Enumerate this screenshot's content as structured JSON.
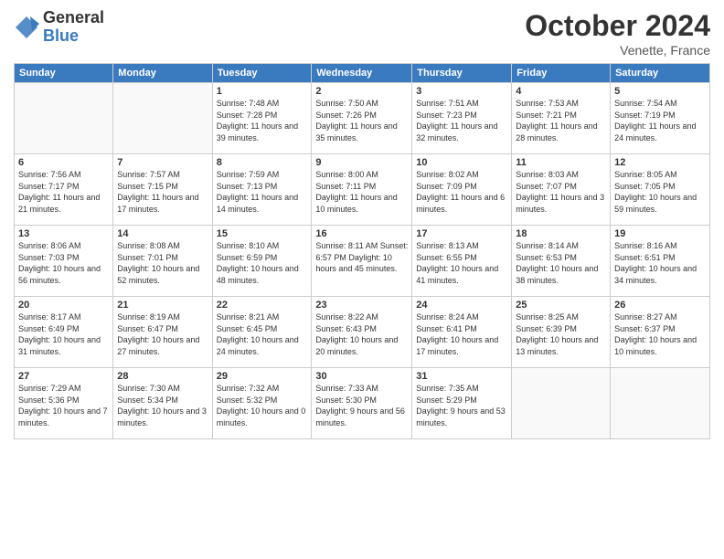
{
  "logo": {
    "general": "General",
    "blue": "Blue"
  },
  "header": {
    "month": "October 2024",
    "location": "Venette, France"
  },
  "weekdays": [
    "Sunday",
    "Monday",
    "Tuesday",
    "Wednesday",
    "Thursday",
    "Friday",
    "Saturday"
  ],
  "weeks": [
    [
      {
        "day": "",
        "info": ""
      },
      {
        "day": "",
        "info": ""
      },
      {
        "day": "1",
        "info": "Sunrise: 7:48 AM\nSunset: 7:28 PM\nDaylight: 11 hours and 39 minutes."
      },
      {
        "day": "2",
        "info": "Sunrise: 7:50 AM\nSunset: 7:26 PM\nDaylight: 11 hours and 35 minutes."
      },
      {
        "day": "3",
        "info": "Sunrise: 7:51 AM\nSunset: 7:23 PM\nDaylight: 11 hours and 32 minutes."
      },
      {
        "day": "4",
        "info": "Sunrise: 7:53 AM\nSunset: 7:21 PM\nDaylight: 11 hours and 28 minutes."
      },
      {
        "day": "5",
        "info": "Sunrise: 7:54 AM\nSunset: 7:19 PM\nDaylight: 11 hours and 24 minutes."
      }
    ],
    [
      {
        "day": "6",
        "info": "Sunrise: 7:56 AM\nSunset: 7:17 PM\nDaylight: 11 hours and 21 minutes."
      },
      {
        "day": "7",
        "info": "Sunrise: 7:57 AM\nSunset: 7:15 PM\nDaylight: 11 hours and 17 minutes."
      },
      {
        "day": "8",
        "info": "Sunrise: 7:59 AM\nSunset: 7:13 PM\nDaylight: 11 hours and 14 minutes."
      },
      {
        "day": "9",
        "info": "Sunrise: 8:00 AM\nSunset: 7:11 PM\nDaylight: 11 hours and 10 minutes."
      },
      {
        "day": "10",
        "info": "Sunrise: 8:02 AM\nSunset: 7:09 PM\nDaylight: 11 hours and 6 minutes."
      },
      {
        "day": "11",
        "info": "Sunrise: 8:03 AM\nSunset: 7:07 PM\nDaylight: 11 hours and 3 minutes."
      },
      {
        "day": "12",
        "info": "Sunrise: 8:05 AM\nSunset: 7:05 PM\nDaylight: 10 hours and 59 minutes."
      }
    ],
    [
      {
        "day": "13",
        "info": "Sunrise: 8:06 AM\nSunset: 7:03 PM\nDaylight: 10 hours and 56 minutes."
      },
      {
        "day": "14",
        "info": "Sunrise: 8:08 AM\nSunset: 7:01 PM\nDaylight: 10 hours and 52 minutes."
      },
      {
        "day": "15",
        "info": "Sunrise: 8:10 AM\nSunset: 6:59 PM\nDaylight: 10 hours and 48 minutes."
      },
      {
        "day": "16",
        "info": "Sunrise: 8:11 AM\nSunset: 6:57 PM\nDaylight: 10 hours and 45 minutes."
      },
      {
        "day": "17",
        "info": "Sunrise: 8:13 AM\nSunset: 6:55 PM\nDaylight: 10 hours and 41 minutes."
      },
      {
        "day": "18",
        "info": "Sunrise: 8:14 AM\nSunset: 6:53 PM\nDaylight: 10 hours and 38 minutes."
      },
      {
        "day": "19",
        "info": "Sunrise: 8:16 AM\nSunset: 6:51 PM\nDaylight: 10 hours and 34 minutes."
      }
    ],
    [
      {
        "day": "20",
        "info": "Sunrise: 8:17 AM\nSunset: 6:49 PM\nDaylight: 10 hours and 31 minutes."
      },
      {
        "day": "21",
        "info": "Sunrise: 8:19 AM\nSunset: 6:47 PM\nDaylight: 10 hours and 27 minutes."
      },
      {
        "day": "22",
        "info": "Sunrise: 8:21 AM\nSunset: 6:45 PM\nDaylight: 10 hours and 24 minutes."
      },
      {
        "day": "23",
        "info": "Sunrise: 8:22 AM\nSunset: 6:43 PM\nDaylight: 10 hours and 20 minutes."
      },
      {
        "day": "24",
        "info": "Sunrise: 8:24 AM\nSunset: 6:41 PM\nDaylight: 10 hours and 17 minutes."
      },
      {
        "day": "25",
        "info": "Sunrise: 8:25 AM\nSunset: 6:39 PM\nDaylight: 10 hours and 13 minutes."
      },
      {
        "day": "26",
        "info": "Sunrise: 8:27 AM\nSunset: 6:37 PM\nDaylight: 10 hours and 10 minutes."
      }
    ],
    [
      {
        "day": "27",
        "info": "Sunrise: 7:29 AM\nSunset: 5:36 PM\nDaylight: 10 hours and 7 minutes."
      },
      {
        "day": "28",
        "info": "Sunrise: 7:30 AM\nSunset: 5:34 PM\nDaylight: 10 hours and 3 minutes."
      },
      {
        "day": "29",
        "info": "Sunrise: 7:32 AM\nSunset: 5:32 PM\nDaylight: 10 hours and 0 minutes."
      },
      {
        "day": "30",
        "info": "Sunrise: 7:33 AM\nSunset: 5:30 PM\nDaylight: 9 hours and 56 minutes."
      },
      {
        "day": "31",
        "info": "Sunrise: 7:35 AM\nSunset: 5:29 PM\nDaylight: 9 hours and 53 minutes."
      },
      {
        "day": "",
        "info": ""
      },
      {
        "day": "",
        "info": ""
      }
    ]
  ]
}
